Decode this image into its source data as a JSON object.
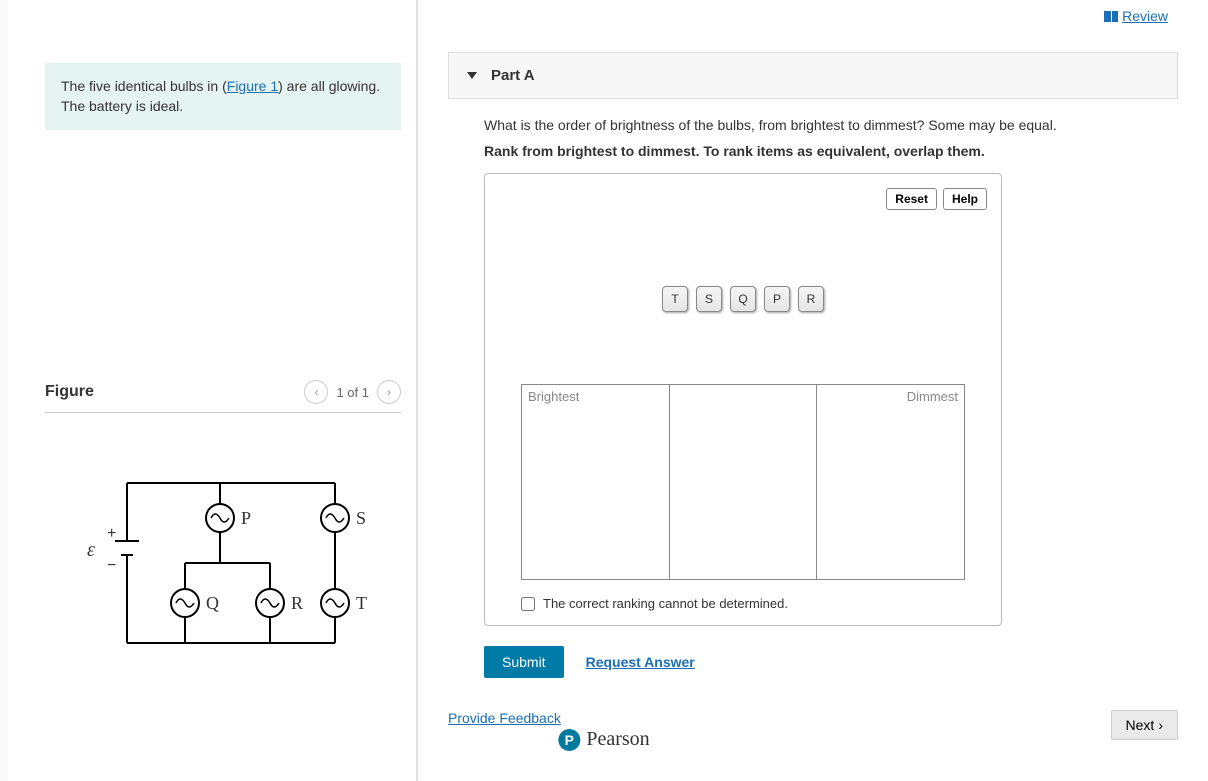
{
  "review_link": "Review",
  "problem": {
    "intro_pre": "The five identical bulbs in (",
    "figure_link": "Figure 1",
    "intro_post": ") are all glowing. The battery is ideal."
  },
  "figure": {
    "title": "Figure",
    "pager": "1 of 1",
    "emf": "ε",
    "plus": "+",
    "minus": "−",
    "bulbs": {
      "P": "P",
      "S": "S",
      "Q": "Q",
      "R": "R",
      "T": "T"
    }
  },
  "part": {
    "label": "Part A",
    "question": "What is the order of brightness of the bulbs, from brightest to dimmest? Some may be equal.",
    "instruction": "Rank from brightest to dimmest. To rank items as equivalent, overlap them."
  },
  "rank": {
    "reset": "Reset",
    "help": "Help",
    "chips": [
      "T",
      "S",
      "Q",
      "P",
      "R"
    ],
    "left_label": "Brightest",
    "right_label": "Dimmest",
    "undetermined": "The correct ranking cannot be determined."
  },
  "actions": {
    "submit": "Submit",
    "request": "Request Answer",
    "feedback": "Provide Feedback",
    "next": "Next"
  },
  "brand": "Pearson"
}
